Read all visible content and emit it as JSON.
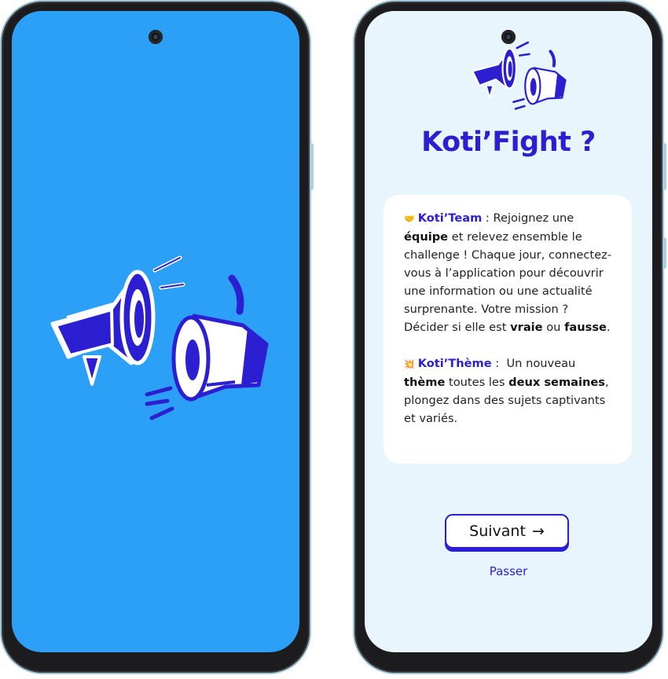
{
  "colors": {
    "splash_background": "#2c9ff7",
    "onboarding_background": "#e8f5fd",
    "brand_accent": "#2b1fd1",
    "card_background": "#ffffff"
  },
  "splash": {
    "logo_icon": "megaphones-icon"
  },
  "onboarding": {
    "logo_icon": "megaphones-icon",
    "title": "Koti’Fight ?",
    "team": {
      "emoji": "🤝",
      "label": "Koti’Team",
      "sep": " : ",
      "t1": "Rejoignez une ",
      "b1": "équipe",
      "t2": " et relevez ensemble le challenge ! Chaque jour, connectez-vous à l’application pour découvrir une information ou une actualité surprenante. Votre mission ? Décider si elle est ",
      "b2": "vraie",
      "t3": " ou ",
      "b3": "fausse",
      "t4": "."
    },
    "theme": {
      "emoji": "💥",
      "label": "Koti’Thème",
      "sep": " :  ",
      "t1": "Un nouveau ",
      "b1": "thème",
      "t2": " toutes les ",
      "b2": "deux semaines",
      "t3": ", plongez dans des sujets captivants et variés."
    },
    "next_label": "Suivant",
    "next_arrow": "→",
    "skip_label": "Passer"
  }
}
